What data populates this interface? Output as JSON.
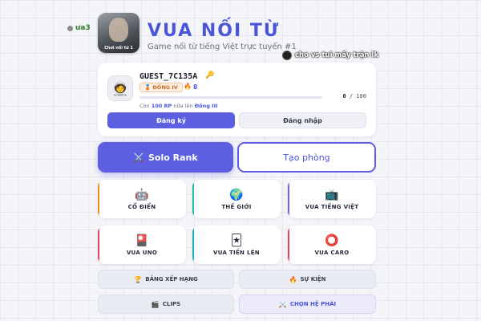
{
  "header": {
    "title": "VUA NỐI TỪ",
    "subtitle": "Game nối từ tiếng Việt trực tuyến #1",
    "logo_caption": "Chơi nối từ 1"
  },
  "floating_chats": {
    "left_text": "ưa3",
    "right_text": "cho vs tui mấy trận lk"
  },
  "profile": {
    "username": "GUEST_7C135A",
    "rank": "ĐỒNG IV",
    "streak": "8",
    "progress_current": "0",
    "progress_separator": "/",
    "progress_max": "100",
    "progress_fraction": 0,
    "rp_note_prefix": "Còn",
    "rp_note_amount": "100 RP",
    "rp_note_middle": "nữa lên",
    "rp_note_target": "Đồng III",
    "register_label": "Đăng ký",
    "login_label": "Đăng nhập"
  },
  "main_actions": {
    "solo_icon": "⚔️",
    "solo_label": "Solo Rank",
    "create_label": "Tạo phòng"
  },
  "modes": [
    {
      "label": "CỔ ĐIỂN",
      "icon": "🤖",
      "icon_name": "robot-icon",
      "accent": "#e98a2a"
    },
    {
      "label": "THẾ GIỚI",
      "icon": "🌍",
      "icon_name": "globe-icon",
      "accent": "#1fb8a6"
    },
    {
      "label": "VUA TIẾNG VIỆT",
      "icon": "📺",
      "icon_name": "tv-icon",
      "accent": "#7b5fe0"
    },
    {
      "label": "VUA UNO",
      "icon": "🎴",
      "icon_name": "uno-card-icon",
      "accent": "#e0455b"
    },
    {
      "label": "VUA TIẾN LÊN",
      "icon": "🃏",
      "icon_name": "playing-card-icon",
      "accent": "#22b0c0"
    },
    {
      "label": "VUA CARO",
      "icon": "⭕",
      "icon_name": "circle-icon",
      "accent": "#e0455b"
    }
  ],
  "utilities": [
    {
      "label": "BẢNG XẾP HẠNG",
      "icon": "🏆",
      "icon_name": "trophy-icon"
    },
    {
      "label": "SỰ KIỆN",
      "icon": "🔥",
      "icon_name": "fire-icon"
    },
    {
      "label": "CLIPS",
      "icon": "🎬",
      "icon_name": "clapper-icon"
    },
    {
      "label": "CHỌN HỆ PHÁI",
      "icon": "⚔️",
      "icon_name": "crossed-swords-icon"
    }
  ],
  "colors": {
    "primary": "#5b5fe0",
    "title": "#4b55d8",
    "rank_badge": "#c46b2a"
  }
}
